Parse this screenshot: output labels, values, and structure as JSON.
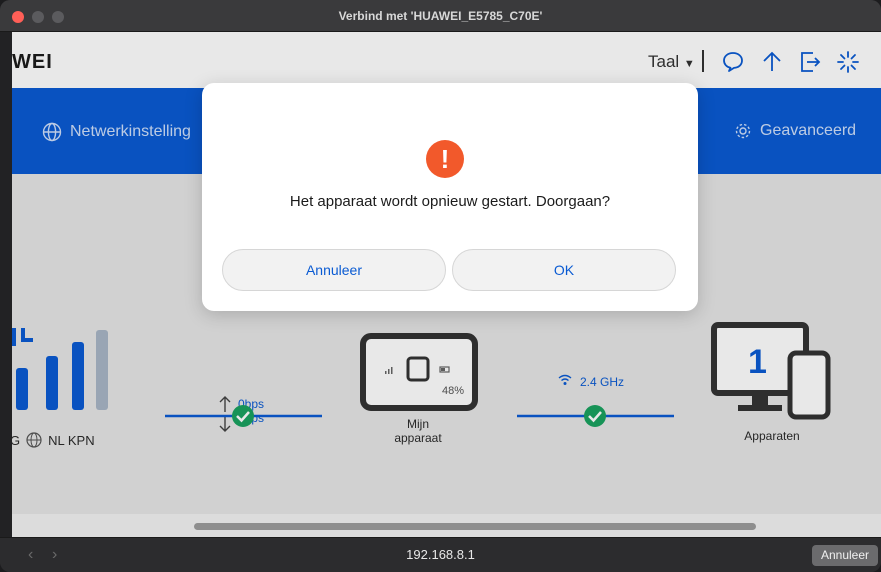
{
  "window": {
    "title": "Verbind met 'HUAWEI_E5785_C70E'"
  },
  "header": {
    "logo_text": "WEI",
    "language": "Taal",
    "icons": [
      "chat-icon",
      "upload-arrow-icon",
      "logout-icon",
      "loading-spinner-icon"
    ]
  },
  "nav": {
    "network_settings": "Netwerkinstelling",
    "advanced": "Geavanceerd"
  },
  "status": {
    "network_letter": "G",
    "carrier": "NL KPN",
    "upload_rate": "0bps",
    "download_rate": "0bps",
    "device_label_line1": "Mijn",
    "device_label_line2": "apparaat",
    "battery": "48%",
    "wifi_band": "2.4 GHz",
    "devices_count": "1",
    "devices_label": "Apparaten"
  },
  "dialog": {
    "message": "Het apparaat wordt opnieuw gestart. Doorgaan?",
    "cancel_label": "Annuleer",
    "ok_label": "OK"
  },
  "bottom_bar": {
    "url": "192.168.8.1",
    "cancel_label": "Annuleer"
  },
  "colors": {
    "brand_blue": "#0a5bd3",
    "warning_orange": "#f2592b",
    "status_green": "#1aa260",
    "signal_gray": "#a9b6c6"
  }
}
